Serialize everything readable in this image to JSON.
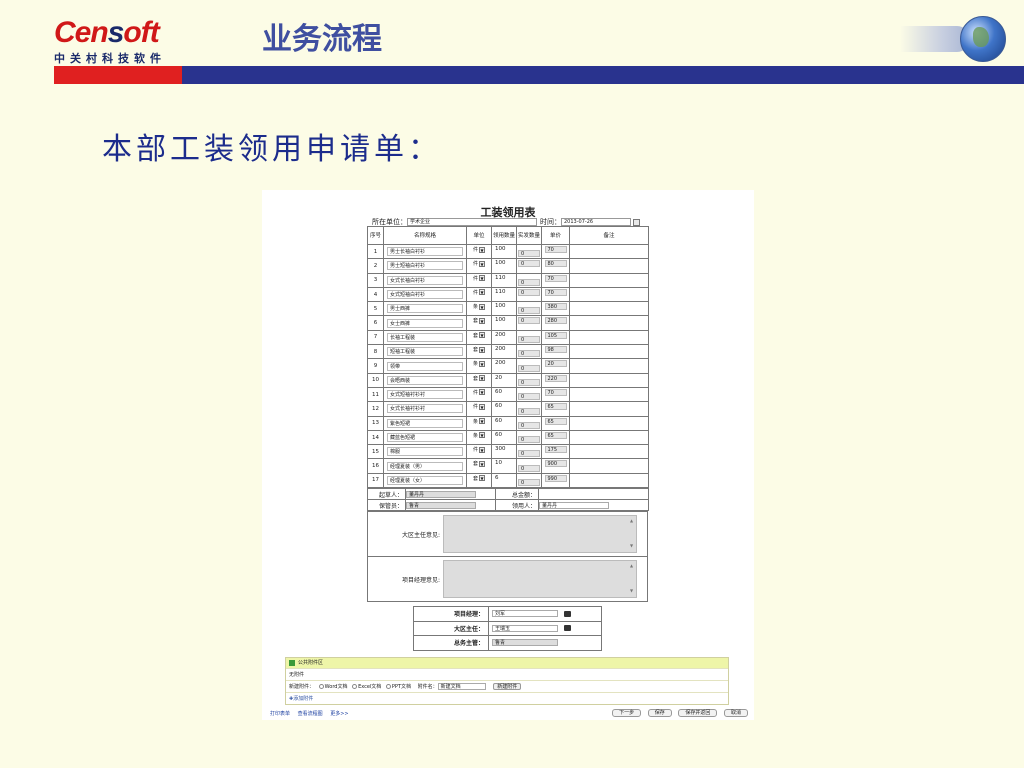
{
  "slide": {
    "logo_word_a": "Cen",
    "logo_word_b": "s",
    "logo_word_c": "o",
    "logo_word_d": "ft",
    "logo_cn": "中关村科技软件",
    "title": "业务流程",
    "subtitle": "本部工装领用申请单："
  },
  "form": {
    "title": "工装领用表",
    "unit_label": "所在单位：",
    "unit_value": "学术企业",
    "time_label": "时间：",
    "time_value": "2013-07-26",
    "headers": [
      "序号",
      "名称规格",
      "单位",
      "领用数量",
      "实发数量",
      "单价",
      "备注"
    ],
    "rows": [
      {
        "no": "1",
        "name": "男士长袖白衬衫",
        "unit": "件",
        "qty": "100",
        "actual": "0",
        "price": "70"
      },
      {
        "no": "2",
        "name": "男士短袖白衬衫",
        "unit": "件",
        "qty": "100",
        "actual": "0",
        "price": "80"
      },
      {
        "no": "3",
        "name": "女式长袖白衬衫",
        "unit": "件",
        "qty": "110",
        "actual": "0",
        "price": "70"
      },
      {
        "no": "4",
        "name": "女式短袖白衬衫",
        "unit": "件",
        "qty": "110",
        "actual": "0",
        "price": "70"
      },
      {
        "no": "5",
        "name": "男士西裤",
        "unit": "条",
        "qty": "100",
        "actual": "0",
        "price": "380"
      },
      {
        "no": "6",
        "name": "女士西裤",
        "unit": "套",
        "qty": "100",
        "actual": "0",
        "price": "280"
      },
      {
        "no": "7",
        "name": "长袖工程装",
        "unit": "套",
        "qty": "200",
        "actual": "0",
        "price": "105"
      },
      {
        "no": "8",
        "name": "短袖工程装",
        "unit": "套",
        "qty": "200",
        "actual": "0",
        "price": "98"
      },
      {
        "no": "9",
        "name": "领带",
        "unit": "条",
        "qty": "200",
        "actual": "0",
        "price": "20"
      },
      {
        "no": "10",
        "name": "会晤西装",
        "unit": "套",
        "qty": "20",
        "actual": "0",
        "price": "220"
      },
      {
        "no": "11",
        "name": "女式短袖衬衫衬",
        "unit": "件",
        "qty": "60",
        "actual": "0",
        "price": "70"
      },
      {
        "no": "12",
        "name": "女式长袖衬衫衬",
        "unit": "件",
        "qty": "60",
        "actual": "0",
        "price": "65"
      },
      {
        "no": "13",
        "name": "紫色短裙",
        "unit": "条",
        "qty": "60",
        "actual": "0",
        "price": "65"
      },
      {
        "no": "14",
        "name": "藏蓝色短裙",
        "unit": "条",
        "qty": "60",
        "actual": "0",
        "price": "65"
      },
      {
        "no": "15",
        "name": "棉服",
        "unit": "件",
        "qty": "300",
        "actual": "0",
        "price": "175"
      },
      {
        "no": "16",
        "name": "经理夏装（男）",
        "unit": "套",
        "qty": "10",
        "actual": "0",
        "price": "900"
      },
      {
        "no": "17",
        "name": "经理夏装（女）",
        "unit": "套",
        "qty": "6",
        "actual": "0",
        "price": "990"
      }
    ],
    "applicant_label": "起草人：",
    "applicant_value": "董丹丹",
    "total_label": "总金额：",
    "keeper_label": "保管员：",
    "keeper_value": "鲁青",
    "recipient_label": "领用人：",
    "recipient_value": "董丹丹",
    "opinion1_label": "大区主任意见:",
    "opinion2_label": "项目经理意见:",
    "approvals": [
      {
        "label": "项目经理：",
        "value": "刘军",
        "has_picker": true
      },
      {
        "label": "大区主任：",
        "value": "王瑞玉",
        "has_picker": true
      },
      {
        "label": "总务主管：",
        "value": "鲁青",
        "has_picker": false
      }
    ],
    "attach": {
      "header": "公共附件区",
      "none_text": "无附件",
      "new_label": "新建附件：",
      "opt_word": "Word文档",
      "opt_excel": "Excel文档",
      "opt_ppt": "PPT文档",
      "filename_label": "附件名：",
      "filename_value": "新建文档",
      "new_btn": "新建附件",
      "add_link": "✚添加附件"
    },
    "footer_links": [
      "打印表单",
      "查看流程图",
      "更多>>"
    ],
    "footer_buttons": [
      "下一步",
      "保存",
      "保存并返回",
      "取消"
    ]
  }
}
